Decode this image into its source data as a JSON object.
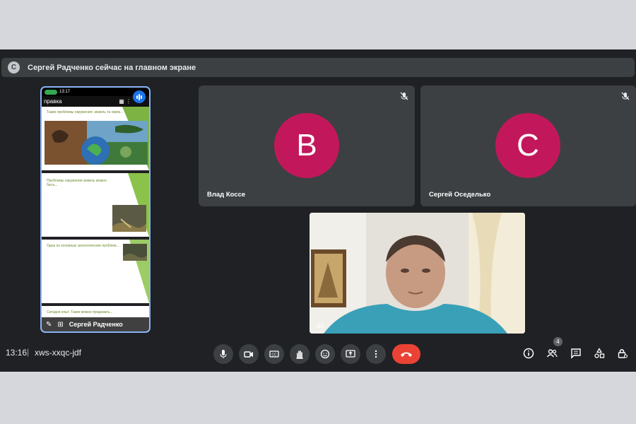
{
  "banner": {
    "avatar_letter": "С",
    "text": "Сергей Радченко сейчас на главном экране"
  },
  "shared_screen": {
    "status_time": "13:17",
    "app_title": "правка",
    "presenter_name": "Сергей Радченко",
    "slide1_text": "Такие проблемы окружения: земель та окрім...",
    "slide2_text": "Проблемы окружения земель можно быть...",
    "slide3_text": "Одна из основных экологических проблем...",
    "slide4_text": "Сегодня опыт. Такие можно продовать..."
  },
  "tiles": [
    {
      "name": "Влад Коссе",
      "letter": "В",
      "avatar_color": "#c2185b"
    },
    {
      "name": "Сергей Оседелько",
      "letter": "С",
      "avatar_color": "#c2185b"
    }
  ],
  "camera_tile": {
    "label": "Ви"
  },
  "bottom_bar": {
    "time": "13:16",
    "separator": "|",
    "meeting_code": "xws-xxqc-jdf",
    "participants_count": "4"
  },
  "icons": {
    "mic": "mic-icon",
    "camera": "camera-icon",
    "captions": "captions-icon",
    "hand": "raise-hand-icon",
    "emoji": "emoji-icon",
    "present": "present-icon",
    "more": "more-vert-icon",
    "end": "end-call-icon",
    "info": "info-icon",
    "people": "people-icon",
    "chat": "chat-icon",
    "activities": "activities-icon",
    "host": "host-controls-icon"
  },
  "colors": {
    "background": "#202124",
    "tile": "#3c4043",
    "avatar": "#c2185b",
    "end_call": "#ea4335",
    "accent": "#8ab4f8"
  }
}
